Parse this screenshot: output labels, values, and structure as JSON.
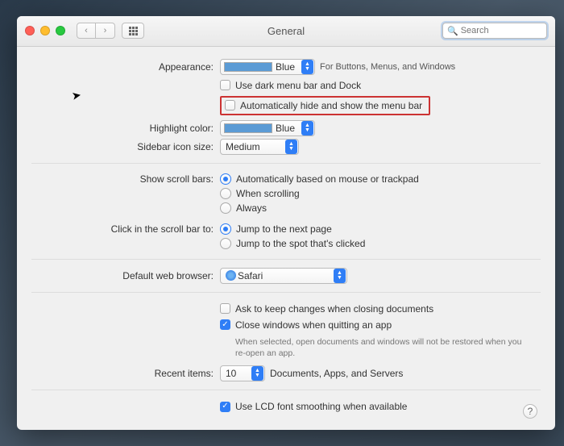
{
  "window": {
    "title": "General",
    "search_placeholder": "Search"
  },
  "appearance": {
    "label": "Appearance:",
    "value": "Blue",
    "hint": "For Buttons, Menus, and Windows",
    "dark_menu": "Use dark menu bar and Dock",
    "auto_hide": "Automatically hide and show the menu bar"
  },
  "highlight": {
    "label": "Highlight color:",
    "value": "Blue"
  },
  "sidebar": {
    "label": "Sidebar icon size:",
    "value": "Medium"
  },
  "scrollbars": {
    "label": "Show scroll bars:",
    "options": [
      "Automatically based on mouse or trackpad",
      "When scrolling",
      "Always"
    ],
    "selected": 0
  },
  "clickbar": {
    "label": "Click in the scroll bar to:",
    "options": [
      "Jump to the next page",
      "Jump to the spot that's clicked"
    ],
    "selected": 0
  },
  "browser": {
    "label": "Default web browser:",
    "value": "Safari"
  },
  "docs": {
    "ask_label": "Ask to keep changes when closing documents",
    "close_label": "Close windows when quitting an app",
    "close_hint": "When selected, open documents and windows will not be restored when you re-open an app."
  },
  "recent": {
    "label": "Recent items:",
    "value": "10",
    "suffix": "Documents, Apps, and Servers"
  },
  "lcd": {
    "label": "Use LCD font smoothing when available"
  }
}
